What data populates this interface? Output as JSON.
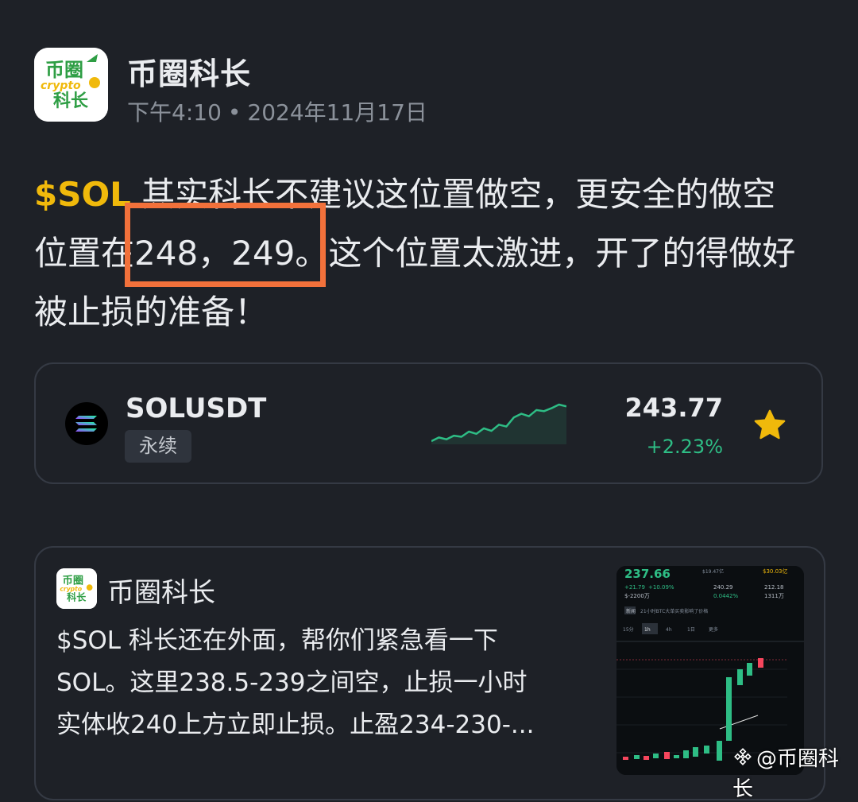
{
  "post": {
    "author": "币圈科长",
    "time": "下午4:10",
    "date": "2024年11月17日",
    "cashtag": "$SOL",
    "line1_rest": " 其实科长不建议这位置做空，更安全的做空",
    "line2": "位置在248，249。这个位置太激进，开了的得做好",
    "line3": "被止损的准备！",
    "logo_text_top": "币圈",
    "logo_text_mid": "crypto",
    "logo_text_bottom": "科长"
  },
  "ticker": {
    "symbol": "SOLUSDT",
    "badge": "永续",
    "price": "243.77",
    "change": "+2.23%",
    "sparkline": [
      2,
      3,
      2.5,
      3.5,
      3.2,
      4.6,
      4,
      5.5,
      4.8,
      6.5,
      6,
      8.5,
      9.5,
      8.8,
      10.5,
      10.2,
      11,
      12,
      11.5
    ],
    "favorite": true
  },
  "quote": {
    "author": "币圈科长",
    "lines": [
      "$SOL 科长还在外面，帮你们紧急看一下",
      "SOL。这里238.5-239之间空，止损一小时",
      "实体收240上方立即止损。止盈234-230-..."
    ],
    "thumb": {
      "price": "237.66",
      "price_suffix": "↗",
      "change_abs": "+21.79",
      "change_pct": "+10.09%",
      "volume": "$-2200万",
      "high_label": "24h最高",
      "high": "$19.47亿",
      "mid": "240.29",
      "funding": "0.0442%",
      "right1": "$30.03亿",
      "right2": "212.18",
      "right3": "1311万",
      "tab_labels": [
        "15分",
        "1h",
        "4h",
        "1日",
        "更多"
      ],
      "news_tag": "新闻",
      "news_text": "21小时BTC大单买卖影响了价格"
    }
  },
  "watermark": "@币圈科长",
  "colors": {
    "background": "#1e2127",
    "accent": "#f0b90b",
    "positive": "#2ebd85",
    "negative": "#f6465d",
    "highlight_box": "#f2713b"
  }
}
